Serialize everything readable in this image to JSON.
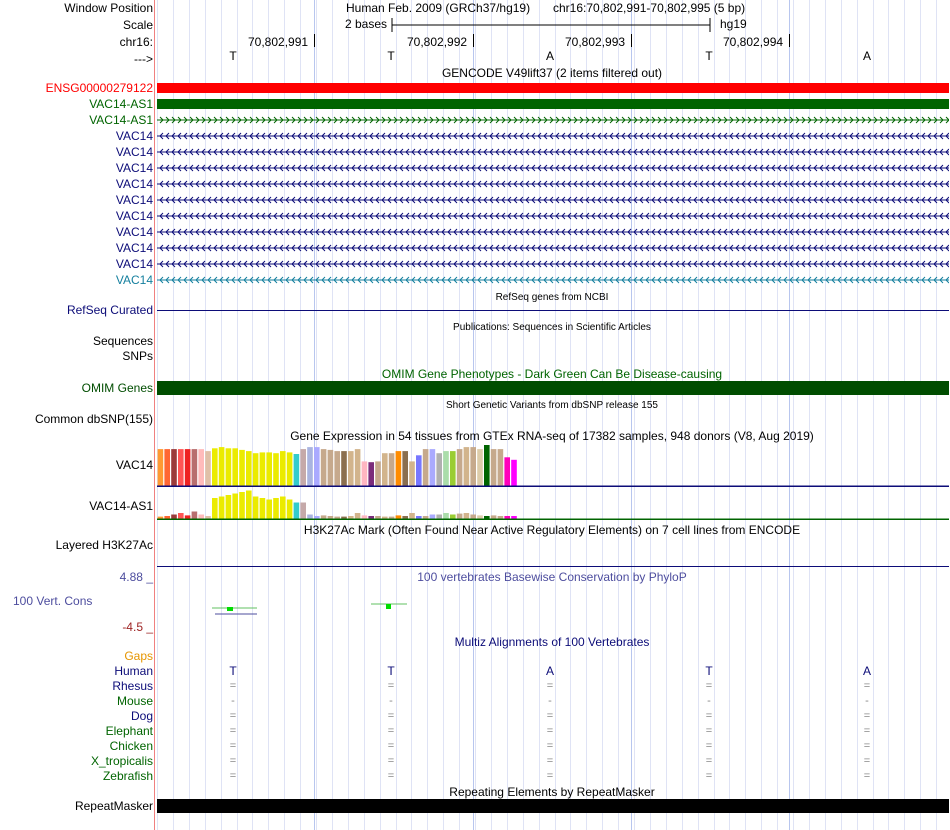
{
  "header": {
    "window_position_label": "Window Position",
    "assembly": "Human Feb. 2009 (GRCh37/hg19)",
    "position": "chr16:70,802,991-70,802,995 (5 bp)",
    "scale_label": "Scale",
    "scale_value": "2 bases",
    "db": "hg19",
    "chrom_label": "chr16:",
    "coords": [
      "70,802,991",
      "70,802,992",
      "70,802,993",
      "70,802,994"
    ],
    "strand_label": "--->",
    "bases": [
      "T",
      "T",
      "A",
      "T",
      "A"
    ]
  },
  "colors": {
    "ensg": "#ff0000",
    "vac14_as1": "#006400",
    "vac14": "#0c0c78",
    "vac14_light": "#147f9e",
    "omim": "#004d00",
    "gaps": "#e69500",
    "conservation": "#4d4d9e",
    "neg": "#9e2424"
  },
  "tracks": {
    "gencode_title": "GENCODE V49lift37 (2 items filtered out)",
    "gencode_items": [
      {
        "name": "ENSG00000279122",
        "kind": "solid",
        "color": "#ff0000"
      },
      {
        "name": "VAC14-AS1",
        "kind": "solid",
        "color": "#006400"
      },
      {
        "name": "VAC14-AS1",
        "kind": "right",
        "color": "#006400"
      },
      {
        "name": "VAC14",
        "kind": "left",
        "color": "#0c0c78"
      },
      {
        "name": "VAC14",
        "kind": "left",
        "color": "#0c0c78"
      },
      {
        "name": "VAC14",
        "kind": "left",
        "color": "#0c0c78"
      },
      {
        "name": "VAC14",
        "kind": "left",
        "color": "#0c0c78"
      },
      {
        "name": "VAC14",
        "kind": "left",
        "color": "#0c0c78"
      },
      {
        "name": "VAC14",
        "kind": "left",
        "color": "#0c0c78"
      },
      {
        "name": "VAC14",
        "kind": "left",
        "color": "#0c0c78"
      },
      {
        "name": "VAC14",
        "kind": "left",
        "color": "#0c0c78"
      },
      {
        "name": "VAC14",
        "kind": "left",
        "color": "#0c0c78"
      },
      {
        "name": "VAC14",
        "kind": "left",
        "color": "#147f9e"
      }
    ],
    "refseq_title": "RefSeq genes from NCBI",
    "refseq_label": "RefSeq Curated",
    "pubs_title": "Publications: Sequences in Scientific Articles",
    "pubs_label1": "Sequences",
    "pubs_label2": "SNPs",
    "omim_title": "OMIM Gene Phenotypes - Dark Green Can Be Disease-causing",
    "omim_label": "OMIM Genes",
    "dbsnp_title": "Short Genetic Variants from dbSNP release 155",
    "dbsnp_label": "Common dbSNP(155)",
    "gtex_title": "Gene Expression in 54 tissues from GTEx RNA-seq of 17382 samples, 948 donors (V8, Aug 2019)",
    "gtex_vac14_label": "VAC14",
    "gtex_as1_label": "VAC14-AS1",
    "h3k_title": "H3K27Ac Mark (Often Found Near Active Regulatory Elements) on 7 cell lines from ENCODE",
    "h3k_label": "Layered H3K27Ac",
    "cons_title": "100 vertebrates Basewise Conservation by PhyloP",
    "cons_label": "100 Vert. Cons",
    "cons_max": "4.88 _",
    "cons_min": "-4.5 _",
    "multiz_title": "Multiz Alignments of 100 Vertebrates",
    "gaps_label": "Gaps",
    "species": [
      {
        "name": "Human",
        "sym": [
          "T",
          "T",
          "A",
          "T",
          "A"
        ],
        "color": "#0c0c78"
      },
      {
        "name": "Rhesus",
        "sym": [
          "=",
          "=",
          "=",
          "=",
          "="
        ],
        "color": "#0c0c78"
      },
      {
        "name": "Mouse",
        "sym": [
          "-",
          "-",
          "-",
          "-",
          "-"
        ],
        "color": "#006400"
      },
      {
        "name": "Dog",
        "sym": [
          "=",
          "=",
          "=",
          "=",
          "="
        ],
        "color": "#0c0c78"
      },
      {
        "name": "Elephant",
        "sym": [
          "=",
          "=",
          "=",
          "=",
          "="
        ],
        "color": "#006400"
      },
      {
        "name": "Chicken",
        "sym": [
          "=",
          "=",
          "=",
          "=",
          "="
        ],
        "color": "#006400"
      },
      {
        "name": "X_tropicalis",
        "sym": [
          "=",
          "=",
          "=",
          "=",
          "="
        ],
        "color": "#006400"
      },
      {
        "name": "Zebrafish",
        "sym": [
          "=",
          "=",
          "=",
          "=",
          "="
        ],
        "color": "#006400"
      }
    ],
    "repeat_title": "Repeating Elements by RepeatMasker",
    "repeat_label": "RepeatMasker"
  },
  "gtex_vac14": {
    "colors": [
      "#ff9933",
      "#ff6633",
      "#9b3b3b",
      "#ff5555",
      "#ee2222",
      "#b86e6e",
      "#ffbbbb",
      "#e0c0a8",
      "#ebeb00",
      "#ebeb00",
      "#ebeb00",
      "#ebeb00",
      "#ebeb00",
      "#ebeb00",
      "#ebeb00",
      "#ebeb00",
      "#ebeb00",
      "#ebeb00",
      "#ebeb00",
      "#ebeb00",
      "#33cccc",
      "#c5a9a9",
      "#a9b4e0",
      "#aaaaff",
      "#c6a98c",
      "#c6a98c",
      "#c6a98c",
      "#8b6f4f",
      "#d2b48c",
      "#d2b48c",
      "#ffb6c1",
      "#7b2d7b",
      "#c6a98c",
      "#d2b48c",
      "#c6a98c",
      "#ff8c00",
      "#8b6f4f",
      "#d2b48c",
      "#7777ff",
      "#c6a98c",
      "#aaaaff",
      "#b0b0b0",
      "#aaddaa",
      "#9acd32",
      "#c6a98c",
      "#d2b48c",
      "#c6a98c",
      "#ddccaa",
      "#006400",
      "#c6a98c",
      "#c6a98c",
      "#ff00bb",
      "#ff00ff"
    ],
    "values": [
      0.9,
      0.9,
      0.9,
      0.9,
      0.9,
      0.9,
      0.9,
      0.85,
      0.92,
      0.95,
      0.92,
      0.92,
      0.88,
      0.85,
      0.8,
      0.82,
      0.82,
      0.8,
      0.85,
      0.82,
      0.78,
      0.9,
      0.95,
      0.95,
      0.9,
      0.88,
      0.85,
      0.85,
      0.85,
      0.9,
      0.6,
      0.58,
      0.6,
      0.8,
      0.8,
      0.85,
      0.85,
      0.6,
      0.75,
      0.9,
      0.9,
      0.8,
      0.85,
      0.85,
      0.9,
      0.95,
      0.95,
      0.9,
      1.0,
      0.9,
      0.9,
      0.7,
      0.64
    ]
  },
  "gtex_as1": {
    "colors": [
      "#ff9933",
      "#ff6633",
      "#9b3b3b",
      "#ff5555",
      "#ee2222",
      "#b86e6e",
      "#ffbbbb",
      "#e0c0a8",
      "#ebeb00",
      "#ebeb00",
      "#ebeb00",
      "#ebeb00",
      "#ebeb00",
      "#ebeb00",
      "#ebeb00",
      "#ebeb00",
      "#ebeb00",
      "#ebeb00",
      "#ebeb00",
      "#ebeb00",
      "#33cccc",
      "#c5a9a9",
      "#a9b4e0",
      "#aaaaff",
      "#c6a98c",
      "#c6a98c",
      "#c6a98c",
      "#8b6f4f",
      "#d2b48c",
      "#d2b48c",
      "#ffb6c1",
      "#7b2d7b",
      "#c6a98c",
      "#d2b48c",
      "#c6a98c",
      "#ff8c00",
      "#8b6f4f",
      "#d2b48c",
      "#7777ff",
      "#c6a98c",
      "#aaaaff",
      "#b0b0b0",
      "#aaddaa",
      "#9acd32",
      "#c6a98c",
      "#d2b48c",
      "#c6a98c",
      "#ddccaa",
      "#006400",
      "#c6a98c",
      "#c6a98c",
      "#ff00bb",
      "#ff00ff"
    ],
    "values": [
      0.08,
      0.1,
      0.15,
      0.2,
      0.12,
      0.25,
      0.15,
      0.1,
      0.7,
      0.75,
      0.8,
      0.85,
      0.9,
      0.95,
      0.75,
      0.7,
      0.65,
      0.7,
      0.75,
      0.65,
      0.55,
      0.55,
      0.15,
      0.1,
      0.12,
      0.1,
      0.08,
      0.08,
      0.1,
      0.2,
      0.12,
      0.1,
      0.1,
      0.08,
      0.08,
      0.12,
      0.1,
      0.2,
      0.1,
      0.1,
      0.15,
      0.15,
      0.2,
      0.15,
      0.18,
      0.2,
      0.15,
      0.12,
      0.1,
      0.12,
      0.1,
      0.1,
      0.1
    ]
  }
}
